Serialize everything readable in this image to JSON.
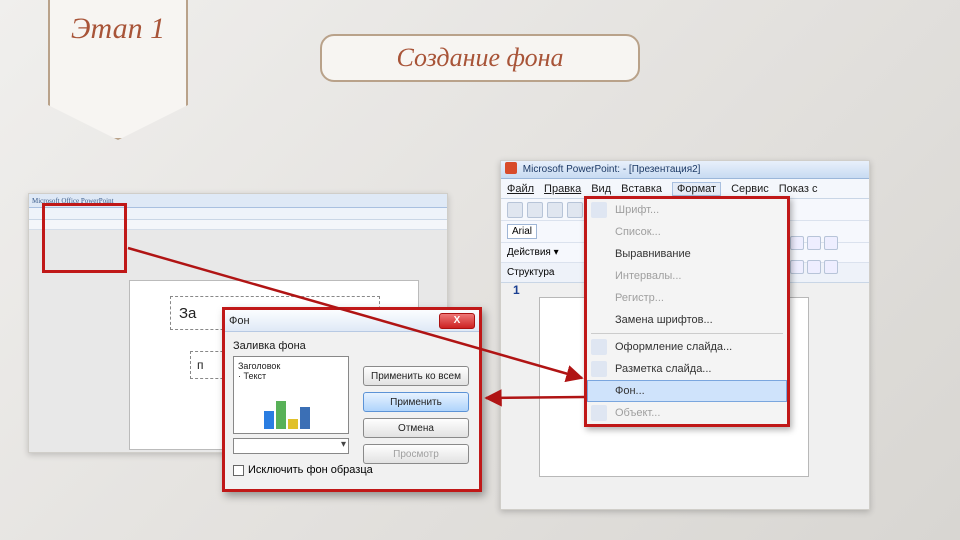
{
  "stage_label": "Этап 1",
  "slide_title": "Создание фона",
  "left_shot": {
    "titlebar": "Microsoft Office PowerPoint",
    "slide_title_placeholder": "За",
    "slide_sub_placeholder": "п"
  },
  "right_shot": {
    "titlebar": "Microsoft PowerPoint: - [Презентация2]",
    "menu": {
      "file": "Файл",
      "edit": "Правка",
      "view": "Вид",
      "insert": "Вставка",
      "format": "Формат",
      "service": "Сервис",
      "slideshow": "Показ с"
    },
    "font_name": "Arial",
    "actions_label": "Действия ▾",
    "tab_label": "Структура",
    "slide_num": "1"
  },
  "dropdown": {
    "items": [
      {
        "label": "Шрифт...",
        "disabled": true,
        "icon": true
      },
      {
        "label": "Список...",
        "disabled": true
      },
      {
        "label": "Выравнивание",
        "disabled": false
      },
      {
        "label": "Интервалы...",
        "disabled": true
      },
      {
        "label": "Регистр...",
        "disabled": true
      },
      {
        "label": "Замена шрифтов...",
        "disabled": false
      },
      {
        "label": "Оформление слайда...",
        "disabled": false,
        "icon": true,
        "sep": true
      },
      {
        "label": "Разметка слайда...",
        "disabled": false,
        "icon": true
      },
      {
        "label": "Фон...",
        "disabled": false,
        "hover": true
      },
      {
        "label": "Объект...",
        "disabled": true,
        "icon": true
      }
    ]
  },
  "dialog": {
    "title": "Фон",
    "close": "X",
    "section_label": "Заливка фона",
    "preview_title": "Заголовок",
    "preview_text": "· Текст",
    "checkbox": "Исключить фон образца",
    "buttons": {
      "apply_all": "Применить ко всем",
      "apply": "Применить",
      "cancel": "Отмена",
      "preview": "Просмотр"
    }
  }
}
